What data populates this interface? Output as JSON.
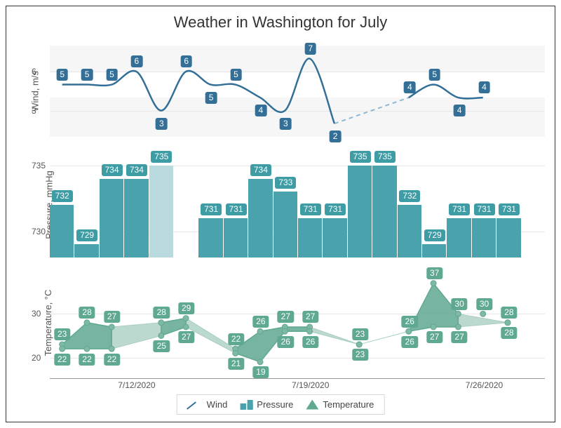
{
  "title": "Weather in Washington for July",
  "axes": {
    "wind": {
      "label": "Wind, m/s",
      "ticks": [
        3,
        6
      ],
      "range": [
        1,
        8
      ]
    },
    "press": {
      "label": "Pressure, mmHg",
      "ticks": [
        730,
        735
      ],
      "range": [
        728,
        736
      ]
    },
    "temp": {
      "label": "Temperature, °C",
      "ticks": [
        20,
        30
      ],
      "range": [
        16,
        40
      ]
    }
  },
  "x": {
    "start": "7/9/2020",
    "ticks": [
      "7/12/2020",
      "7/19/2020",
      "7/26/2020"
    ]
  },
  "legend": {
    "wind": "Wind",
    "pressure": "Pressure",
    "temperature": "Temperature"
  },
  "chart_data": {
    "type": "multi",
    "dates": [
      "7/9/2020",
      "7/10/2020",
      "7/11/2020",
      "7/12/2020",
      "7/13/2020",
      "7/14/2020",
      "7/15/2020",
      "7/16/2020",
      "7/17/2020",
      "7/18/2020",
      "7/19/2020",
      "7/20/2020",
      "7/21/2020",
      "7/22/2020",
      "7/23/2020",
      "7/24/2020",
      "7/25/2020",
      "7/26/2020",
      "7/27/2020",
      "7/28/2020"
    ],
    "wind": [
      5,
      5,
      5,
      6,
      3,
      6,
      5,
      5,
      4,
      3,
      7,
      2,
      null,
      null,
      4,
      5,
      4,
      4,
      null,
      null
    ],
    "pressure": [
      732,
      729,
      734,
      734,
      735,
      null,
      731,
      731,
      734,
      733,
      731,
      731,
      735,
      735,
      732,
      729,
      731,
      731,
      731,
      null
    ],
    "temp_high": [
      23,
      28,
      27,
      null,
      28,
      29,
      null,
      22,
      26,
      27,
      27,
      null,
      23,
      null,
      26,
      37,
      30,
      30,
      28,
      null
    ],
    "temp_low": [
      22,
      22,
      22,
      null,
      25,
      27,
      null,
      21,
      19,
      26,
      26,
      null,
      23,
      null,
      26,
      27,
      27,
      null,
      28,
      null
    ]
  },
  "colors": {
    "wind": "#336f97",
    "pressure": "#4aa3ac",
    "pressure_faded": "#b9dbe0",
    "temperature": "#5fa892"
  }
}
